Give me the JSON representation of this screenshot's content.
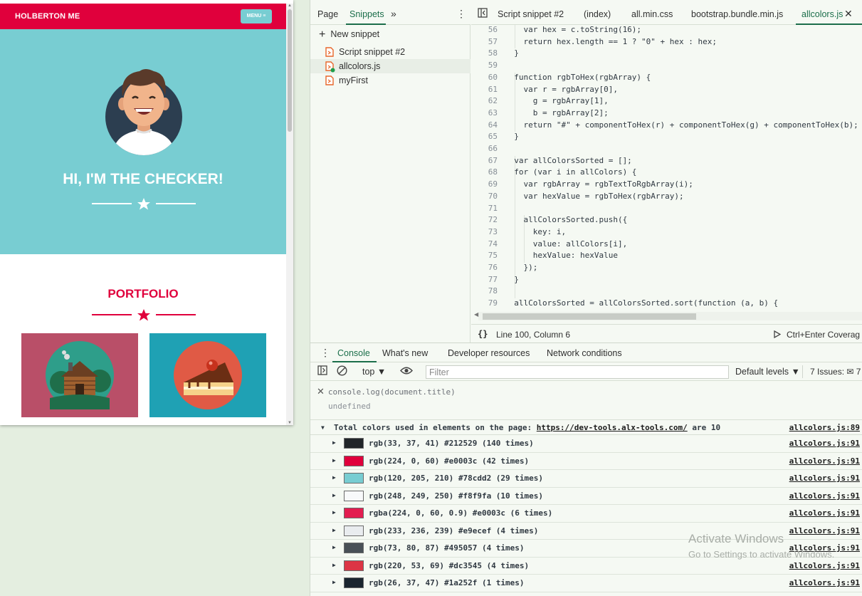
{
  "preview": {
    "brand": "HOLBERTON ME",
    "menu_label": "MENU ≡",
    "hero_title": "HI, I'M THE CHECKER!",
    "portfolio_title": "PORTFOLIO",
    "portfolio_items": [
      {
        "icon": "cabin-icon"
      },
      {
        "icon": "cake-icon"
      }
    ],
    "colors": {
      "primary": "#e0003c",
      "secondary": "#78cdd2",
      "dark": "#212529"
    }
  },
  "devtools": {
    "navigator_tabs": [
      "Page",
      "Snippets"
    ],
    "new_snippet_label": "New snippet",
    "snippets": [
      "Script snippet #2",
      "allcolors.js",
      "myFirst"
    ],
    "editor_tabs": [
      "Script snippet #2",
      "(index)",
      "all.min.css",
      "bootstrap.bundle.min.js",
      "allcolors.js"
    ],
    "active_editor_tab": "allcolors.js",
    "code_lines": [
      {
        "n": "56",
        "code": "    var hex = c.toString(16);"
      },
      {
        "n": "57",
        "code": "    return hex.length == 1 ? \"0\" + hex : hex;"
      },
      {
        "n": "58",
        "code": "  }"
      },
      {
        "n": "59",
        "code": ""
      },
      {
        "n": "60",
        "code": "  function rgbToHex(rgbArray) {"
      },
      {
        "n": "61",
        "code": "    var r = rgbArray[0],"
      },
      {
        "n": "62",
        "code": "      g = rgbArray[1],"
      },
      {
        "n": "63",
        "code": "      b = rgbArray[2];"
      },
      {
        "n": "64",
        "code": "    return \"#\" + componentToHex(r) + componentToHex(g) + componentToHex(b);"
      },
      {
        "n": "65",
        "code": "  }"
      },
      {
        "n": "66",
        "code": ""
      },
      {
        "n": "67",
        "code": "  var allColorsSorted = [];"
      },
      {
        "n": "68",
        "code": "  for (var i in allColors) {"
      },
      {
        "n": "69",
        "code": "    var rgbArray = rgbTextToRgbArray(i);"
      },
      {
        "n": "70",
        "code": "    var hexValue = rgbToHex(rgbArray);"
      },
      {
        "n": "71",
        "code": ""
      },
      {
        "n": "72",
        "code": "    allColorsSorted.push({"
      },
      {
        "n": "73",
        "code": "      key: i,"
      },
      {
        "n": "74",
        "code": "      value: allColors[i],"
      },
      {
        "n": "75",
        "code": "      hexValue: hexValue"
      },
      {
        "n": "76",
        "code": "    });"
      },
      {
        "n": "77",
        "code": "  }"
      },
      {
        "n": "78",
        "code": ""
      },
      {
        "n": "79",
        "code": "  allColorsSorted = allColorsSorted.sort(function (a, b) {"
      }
    ],
    "status": {
      "braces": "{}",
      "position": "Line 100, Column 6",
      "run": "Ctrl+Enter  Coverag"
    },
    "drawer_tabs": [
      "Console",
      "What's new",
      "Developer resources",
      "Network conditions"
    ],
    "console_toolbar": {
      "context": "top ▼",
      "filter_placeholder": "Filter",
      "levels": "Default levels ▼",
      "issues": "7 Issues: ✉ 7"
    },
    "console": {
      "input": "console.log(document.title)",
      "result": "undefined",
      "group_prefix": "Total colors used in elements on the page: ",
      "group_url": "https://dev-tools.alx-tools.com/",
      "group_suffix": " are 10",
      "group_source": "allcolors.js:89",
      "rows": [
        {
          "swatch": "#212529",
          "text": "rgb(33, 37, 41) #212529 (140 times)",
          "source": "allcolors.js:91"
        },
        {
          "swatch": "#e0003c",
          "text": "rgb(224, 0, 60) #e0003c (42 times)",
          "source": "allcolors.js:91"
        },
        {
          "swatch": "#78cdd2",
          "text": "rgb(120, 205, 210) #78cdd2 (29 times)",
          "source": "allcolors.js:91"
        },
        {
          "swatch": "#f8f9fa",
          "text": "rgb(248, 249, 250) #f8f9fa (10 times)",
          "source": "allcolors.js:91"
        },
        {
          "swatch": "#e31d50",
          "text": "rgba(224, 0, 60, 0.9) #e0003c (6 times)",
          "source": "allcolors.js:91"
        },
        {
          "swatch": "#e9ecef",
          "text": "rgb(233, 236, 239) #e9ecef (4 times)",
          "source": "allcolors.js:91"
        },
        {
          "swatch": "#495057",
          "text": "rgb(73, 80, 87) #495057 (4 times)",
          "source": "allcolors.js:91"
        },
        {
          "swatch": "#dc3545",
          "text": "rgb(220, 53, 69) #dc3545 (4 times)",
          "source": "allcolors.js:91"
        },
        {
          "swatch": "#1a252f",
          "text": "rgb(26, 37, 47) #1a252f (1 times)",
          "source": "allcolors.js:91"
        }
      ]
    }
  },
  "watermark": {
    "title": "Activate Windows",
    "subtitle": "Go to Settings to activate Windows."
  }
}
